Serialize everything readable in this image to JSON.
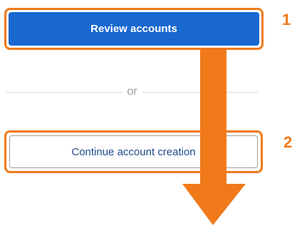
{
  "actions": {
    "review_label": "Review accounts",
    "divider_text": "or",
    "continue_label": "Continue account creation"
  },
  "annotations": {
    "step_1": "1",
    "step_2": "2",
    "arrow_icon": "down-arrow-icon"
  },
  "colors": {
    "primary": "#1868d0",
    "annotation": "#f07a1a",
    "secondary_text": "#1f4b8a"
  }
}
